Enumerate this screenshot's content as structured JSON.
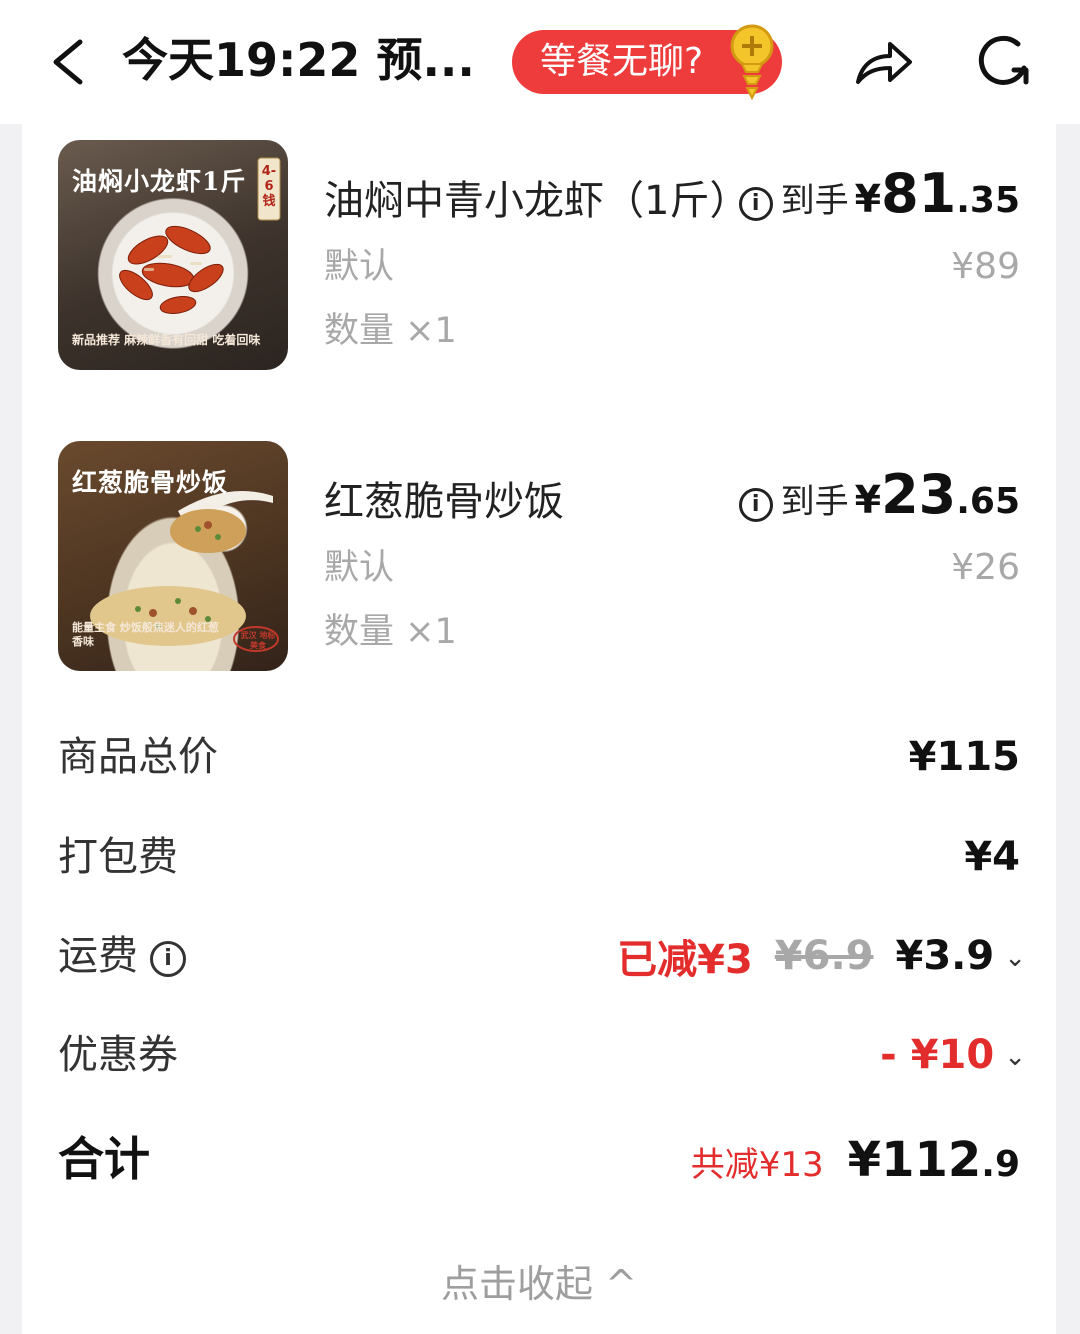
{
  "header": {
    "title": "今天19:22 预...",
    "promo_label": "等餐无聊?",
    "icons": [
      "back-arrow-icon",
      "screw-coin-icon",
      "share-icon",
      "refresh-icon"
    ]
  },
  "items": [
    {
      "thumb_title": "油焖小龙虾1斤",
      "thumb_badge": "4-6钱",
      "thumb_sub": "新品推荐 麻辣鲜香有回甜 吃着回味",
      "name": "油焖中青小龙虾（1斤）",
      "spec": "默认",
      "qty": "数量 ×1",
      "price_prefix": "到手",
      "price_yen": "¥",
      "price_int": "81",
      "price_dec": ".35",
      "orig_price": "¥89"
    },
    {
      "thumb_title": "红葱脆骨炒饭",
      "thumb_badge": "武汉 地标美食",
      "thumb_sub": "能量主食 炒饭般焦迷人的红葱香味",
      "name": "红葱脆骨炒饭",
      "spec": "默认",
      "qty": "数量 ×1",
      "price_prefix": "到手",
      "price_yen": "¥",
      "price_int": "23",
      "price_dec": ".65",
      "orig_price": "¥26"
    }
  ],
  "summary": {
    "goods_total_label": "商品总价",
    "goods_total_value": "¥115",
    "packing_label": "打包费",
    "packing_value": "¥4",
    "delivery_label": "运费",
    "delivery_discount": "已减¥3",
    "delivery_original": "¥6.9",
    "delivery_value": "¥3.9",
    "coupon_label": "优惠券",
    "coupon_value": "- ¥10",
    "total_label": "合计",
    "total_saved": "共减¥13",
    "total_value_int": "¥112",
    "total_value_dec": ".9",
    "collapse_label": "点击收起 ^"
  },
  "colors": {
    "accent_red": "#e32d2d",
    "promo_bg": "#ee3b3b",
    "muted": "#a8a8a8"
  }
}
